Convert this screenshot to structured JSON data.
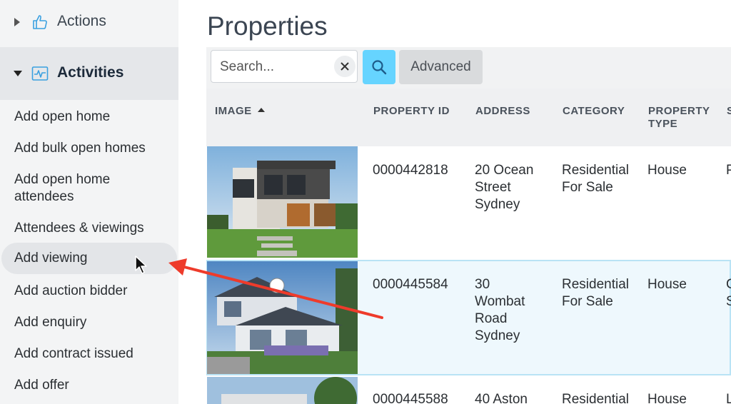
{
  "sidebar": {
    "actions_label": "Actions",
    "activities_label": "Activities",
    "items": [
      {
        "label": "Add open home"
      },
      {
        "label": "Add bulk open homes"
      },
      {
        "label": "Add open home attendees"
      },
      {
        "label": "Attendees & viewings"
      },
      {
        "label": "Add viewing"
      },
      {
        "label": "Add auction bidder"
      },
      {
        "label": "Add enquiry"
      },
      {
        "label": "Add contract issued"
      },
      {
        "label": "Add offer"
      }
    ]
  },
  "main": {
    "title": "Properties",
    "search": {
      "placeholder": "Search...",
      "value": ""
    },
    "advanced_label": "Advanced",
    "columns": [
      "IMAGE",
      "PROPERTY ID",
      "ADDRESS",
      "CATEGORY",
      "PROPERTY TYPE",
      "S"
    ],
    "rows": [
      {
        "property_id": "0000442818",
        "address": "20 Ocean Street Sydney",
        "category": "Residential For Sale",
        "type": "House",
        "status": "P"
      },
      {
        "property_id": "0000445584",
        "address": "30 Wombat Road Sydney",
        "category": "Residential For Sale",
        "type": "House",
        "status": "C S"
      },
      {
        "property_id": "0000445588",
        "address": "40 Aston",
        "category": "Residential",
        "type": "House",
        "status": "L"
      }
    ]
  },
  "colors": {
    "accent": "#66d4ff",
    "annotation_arrow": "#ee3b2b",
    "sidebar_bg": "#f3f4f5"
  }
}
